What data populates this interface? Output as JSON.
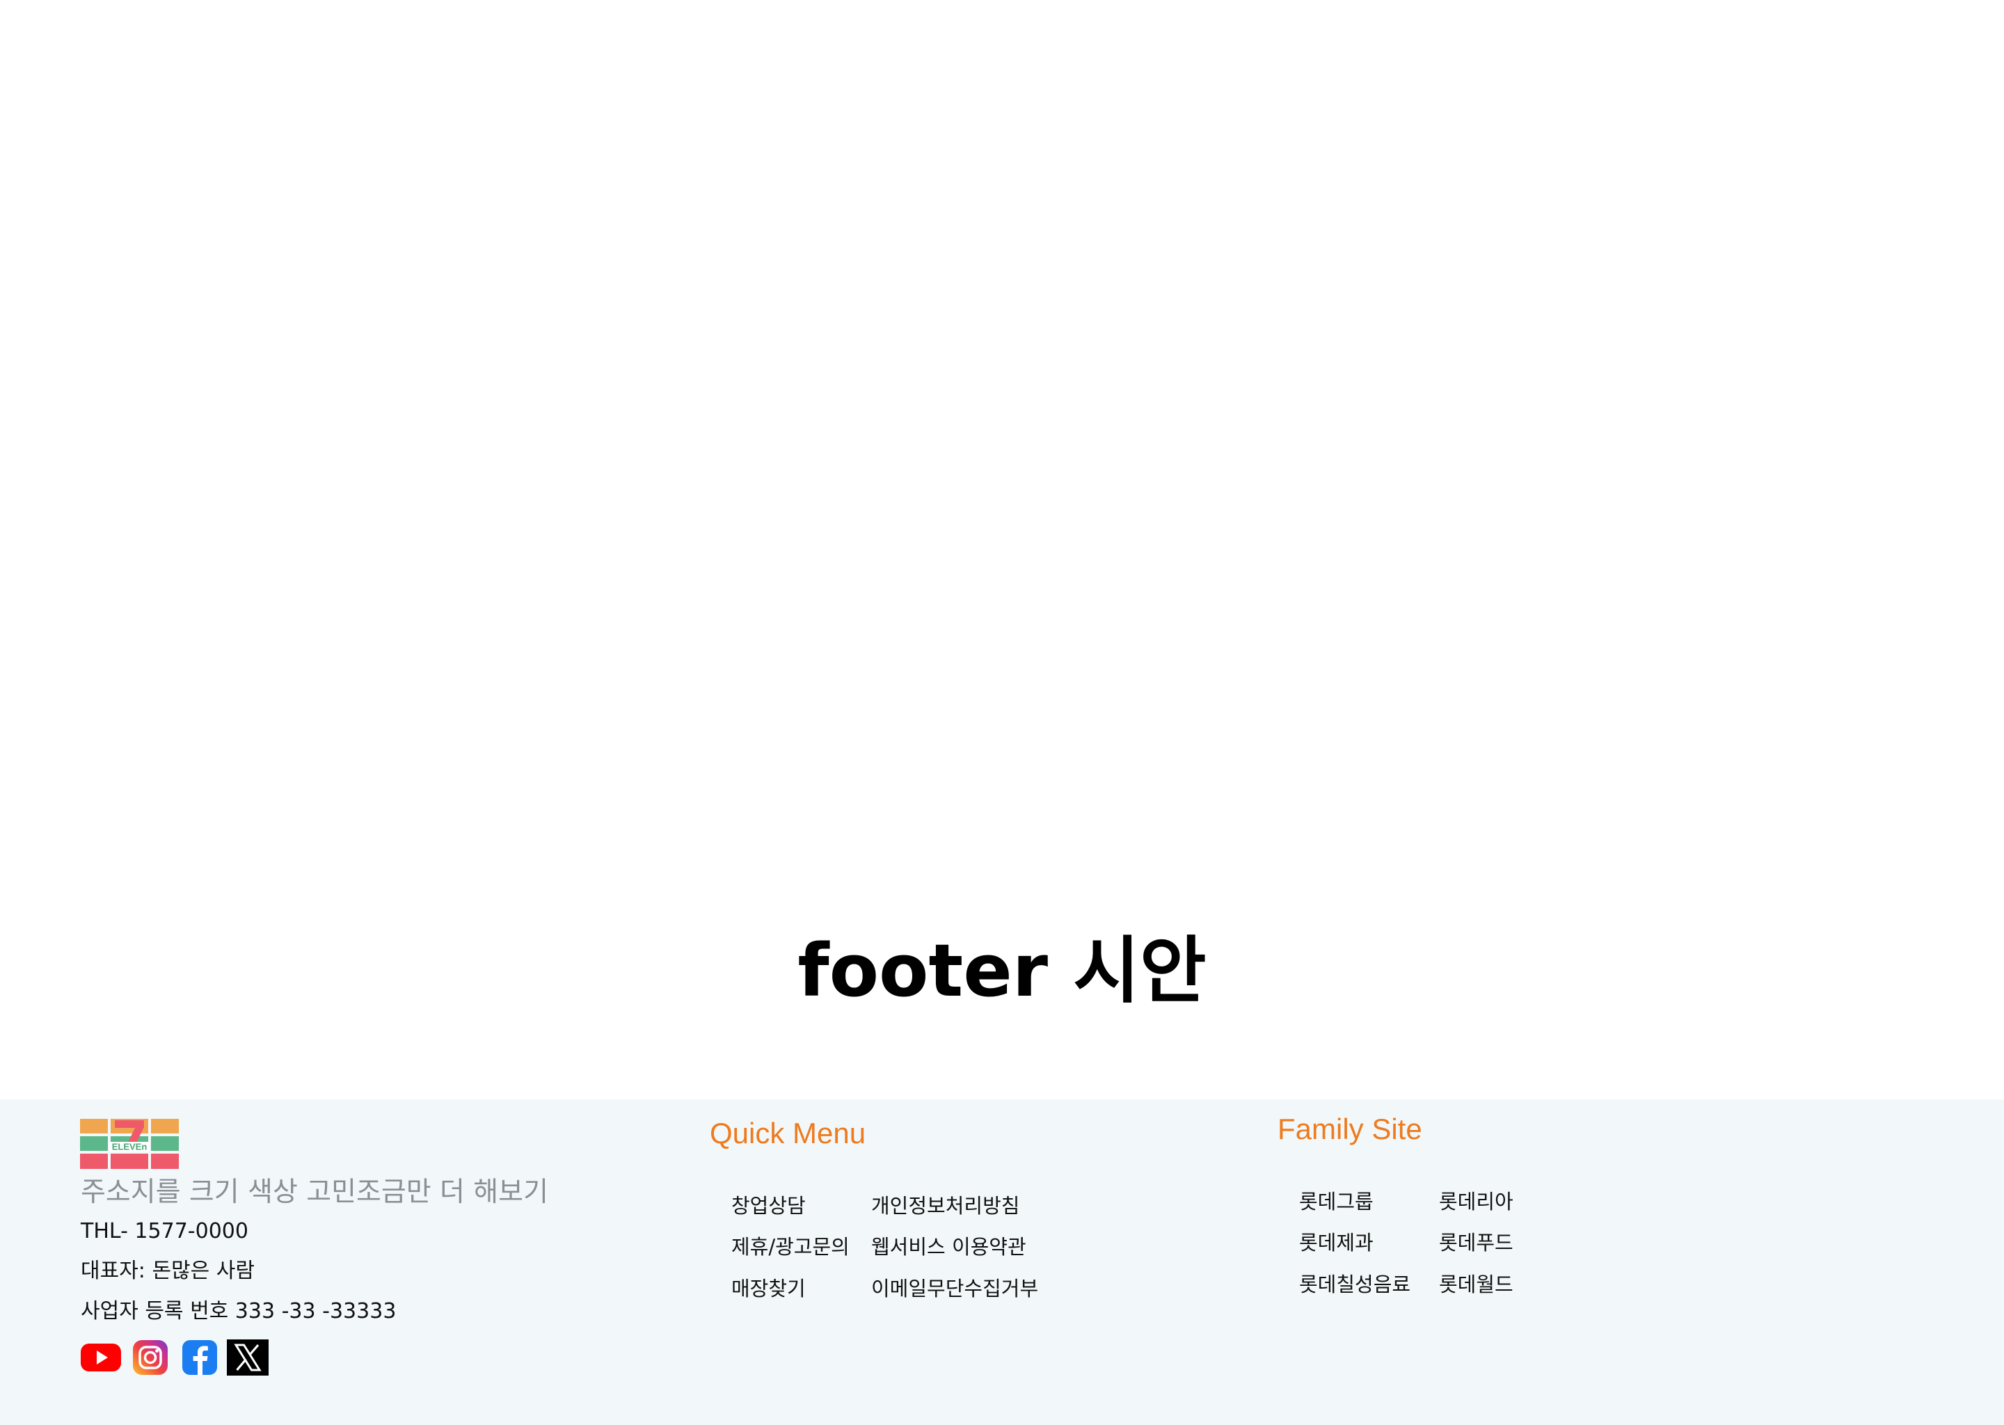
{
  "main": {
    "heading": "footer 시안"
  },
  "footer": {
    "logo_icon": "seven-eleven-logo",
    "logo_text": "ELEVEn",
    "address": "주소지를 크기 색상 고민조금만 더 해보기",
    "tel": "THL- 1577-0000",
    "ceo": "대표자: 돈많은 사람",
    "business_number": "사업자 등록 번호 333 -33 -33333",
    "social": [
      {
        "icon": "youtube-icon"
      },
      {
        "icon": "instagram-icon"
      },
      {
        "icon": "facebook-icon"
      },
      {
        "icon": "x-icon"
      }
    ],
    "quick_menu": {
      "title": "Quick Menu",
      "items": [
        "창업상담",
        "개인정보처리방침",
        "제휴/광고문의",
        "웹서비스 이용약관",
        "매장찾기",
        "이메일무단수집거부"
      ]
    },
    "family_site": {
      "title": "Family Site",
      "items": [
        "롯데그룹",
        "롯데리아",
        "롯데제과",
        "롯데푸드",
        "롯데칠성음료",
        "롯데월드"
      ]
    },
    "colors": {
      "background": "#f2f8fa",
      "accent": "#ee7b1f",
      "address_text": "#8a8f94",
      "logo_orange": "#f0a64f",
      "logo_green": "#5cb88a",
      "logo_red": "#ee5a6a"
    }
  }
}
